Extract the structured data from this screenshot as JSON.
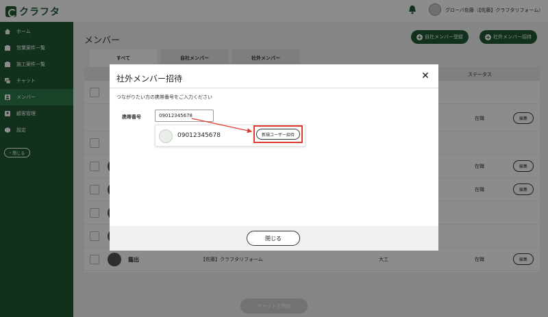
{
  "app": {
    "logo_text": "クラフタ"
  },
  "topbar": {
    "user_name": "グローバ佐藤（【佐藤】クラフタリフォーム）"
  },
  "sidebar": {
    "items": [
      {
        "label": "ホーム",
        "icon": "home-icon"
      },
      {
        "label": "営業案件一覧",
        "icon": "list-icon"
      },
      {
        "label": "施工案件一覧",
        "icon": "list-icon"
      },
      {
        "label": "チャット",
        "icon": "chat-icon"
      },
      {
        "label": "メンバー",
        "icon": "members-icon"
      },
      {
        "label": "顧客管理",
        "icon": "customers-icon"
      },
      {
        "label": "設定",
        "icon": "settings-icon"
      }
    ],
    "active_index": 4,
    "close_label": "閉じる"
  },
  "main": {
    "title": "メンバー",
    "btn_register": "自社メンバー登録",
    "btn_invite": "社外メンバー招待",
    "tabs": [
      "すべて",
      "自社メンバー",
      "社外メンバー"
    ],
    "status_header": "ステータス",
    "rows": [
      {
        "status": "",
        "edit": ""
      },
      {
        "status": "在職",
        "edit": "編集"
      },
      {
        "status": "",
        "edit": ""
      },
      {
        "status": "在職",
        "edit": "編集"
      },
      {
        "status": "在職",
        "edit": "編集"
      },
      {
        "status": "",
        "edit": ""
      },
      {
        "status": "",
        "edit": ""
      },
      {
        "name": "霜出",
        "company": "【佐藤】クラフタリフォーム",
        "job": "大工",
        "status": "在職",
        "edit": "編集"
      }
    ],
    "chat_start": "チャットを開始"
  },
  "modal": {
    "title": "社外メンバー招待",
    "description": "つながりたい方の携帯番号をご入力ください",
    "phone_label": "携帯番号",
    "phone_value": "09012345678",
    "suggest_phone": "09012345678",
    "invite_label": "新規ユーザー招待",
    "close_label": "閉じる"
  },
  "colors": {
    "brand": "#1f5a36",
    "highlight": "#e0392b"
  }
}
